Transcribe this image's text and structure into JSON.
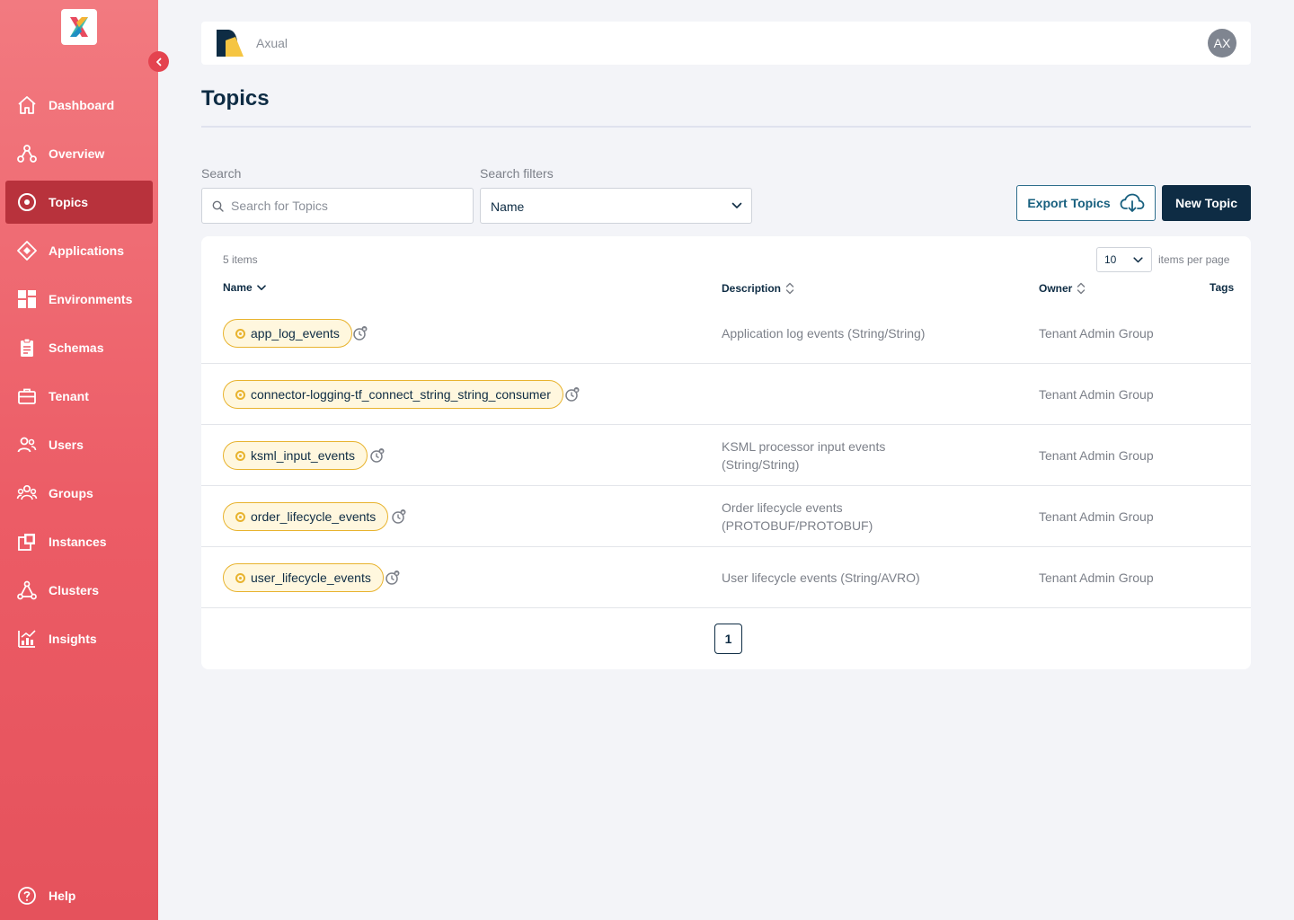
{
  "sidebar": {
    "items": [
      {
        "label": "Dashboard",
        "icon": "home-icon"
      },
      {
        "label": "Overview",
        "icon": "overview-icon"
      },
      {
        "label": "Topics",
        "icon": "topics-icon",
        "active": true
      },
      {
        "label": "Applications",
        "icon": "applications-icon"
      },
      {
        "label": "Environments",
        "icon": "environments-icon"
      },
      {
        "label": "Schemas",
        "icon": "schemas-icon"
      },
      {
        "label": "Tenant",
        "icon": "tenant-icon"
      },
      {
        "label": "Users",
        "icon": "users-icon"
      },
      {
        "label": "Groups",
        "icon": "groups-icon"
      },
      {
        "label": "Instances",
        "icon": "instances-icon"
      },
      {
        "label": "Clusters",
        "icon": "clusters-icon"
      },
      {
        "label": "Insights",
        "icon": "insights-icon"
      }
    ],
    "help_label": "Help"
  },
  "header": {
    "tenant_name": "Axual",
    "avatar_initials": "AX"
  },
  "page": {
    "title": "Topics"
  },
  "filters": {
    "search_label": "Search",
    "search_placeholder": "Search for Topics",
    "filter_label": "Search filters",
    "filter_value": "Name"
  },
  "actions": {
    "export_label": "Export Topics",
    "new_label": "New Topic"
  },
  "table": {
    "items_count": "5 items",
    "per_page": "10",
    "per_page_label": "items per page",
    "columns": {
      "name": "Name",
      "description": "Description",
      "owner": "Owner",
      "tags": "Tags"
    },
    "rows": [
      {
        "name": "app_log_events",
        "description": "Application log events (String/String)",
        "owner": "Tenant Admin Group"
      },
      {
        "name": "connector-logging-tf_connect_string_string_consumer",
        "description": "",
        "owner": "Tenant Admin Group"
      },
      {
        "name": "ksml_input_events",
        "description": "KSML processor input events (String/String)",
        "owner": "Tenant Admin Group"
      },
      {
        "name": "order_lifecycle_events",
        "description": "Order lifecycle events (PROTOBUF/PROTOBUF)",
        "owner": "Tenant Admin Group"
      },
      {
        "name": "user_lifecycle_events",
        "description": "User lifecycle events (String/AVRO)",
        "owner": "Tenant Admin Group"
      }
    ],
    "current_page": "1"
  },
  "colors": {
    "sidebar_top": "#f27a80",
    "sidebar_bottom": "#e5525c",
    "active_nav": "#b8323c",
    "primary": "#0e2c44",
    "topic_pill": "#e8b32e"
  }
}
